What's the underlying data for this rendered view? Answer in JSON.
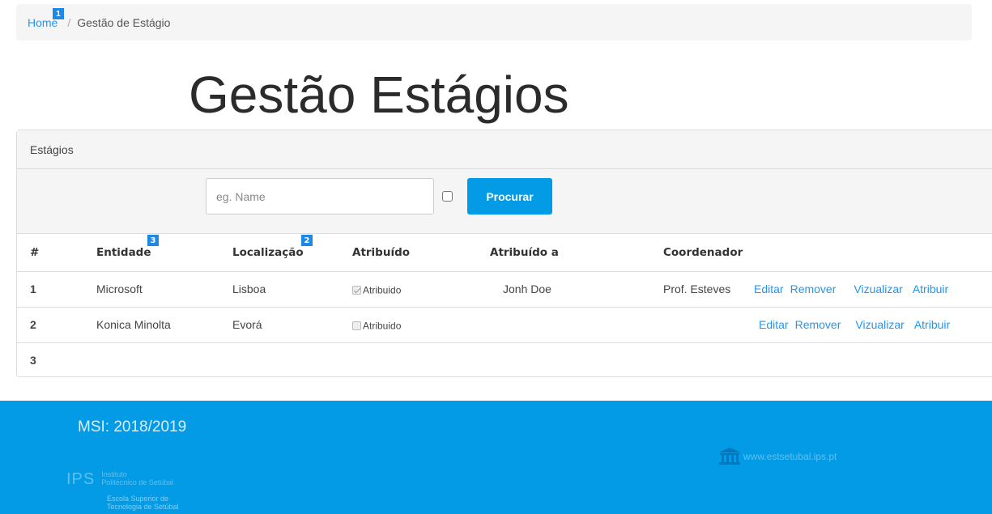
{
  "breadcrumb": {
    "home": "Home",
    "separator": "/",
    "current": "Gestão de Estágio"
  },
  "badges": {
    "home": "1",
    "localizacao": "2",
    "entidade": "3"
  },
  "page_title": "Gestão Estágios",
  "panel": {
    "heading": "Estágios"
  },
  "search": {
    "placeholder": "eg. Name",
    "button_label": "Procurar"
  },
  "table": {
    "headers": [
      "#",
      "Entidade",
      "Localização",
      "Atribuído",
      "Atribuído a",
      "Coordenador"
    ],
    "rows": [
      {
        "num": "1",
        "entidade": "Microsoft",
        "localizacao": "Lisboa",
        "atribuido_label": "Atribuido",
        "atribuido_checked": true,
        "atribuido_a": "Jonh Doe",
        "coordenador": "Prof. Esteves"
      },
      {
        "num": "2",
        "entidade": "Konica Minolta",
        "localizacao": "Evorá",
        "atribuido_label": "Atribuido",
        "atribuido_checked": false,
        "atribuido_a": "",
        "coordenador": ""
      },
      {
        "num": "3"
      }
    ],
    "actions": {
      "edit": "Editar",
      "remove": "Remover",
      "view": "Vizualizar",
      "assign": "Atribuir"
    }
  },
  "footer": {
    "msi": "MSI: 2018/2019",
    "ips_abbr": "IPS",
    "ips_line1": "Instituto",
    "ips_line2": "Politécnico de Setúbal",
    "est_line1": "Escola Superior de",
    "est_line2": "Tecnologia de Setúbal",
    "website": "www.estsetubal.ips.pt",
    "icon": "institution-icon"
  },
  "colors": {
    "accent": "#039be5",
    "link": "#2196f3",
    "badge": "#1e88e5"
  }
}
